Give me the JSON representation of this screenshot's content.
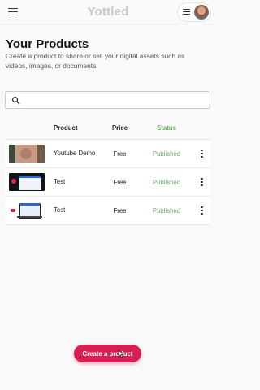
{
  "app": {
    "brand": "Yottled"
  },
  "header": {
    "title": "Your Products",
    "subtitle": "Create a product to share or sell your digital assets such as videos, images, or documents."
  },
  "search": {
    "value": "",
    "placeholder": ""
  },
  "table": {
    "columns": [
      "Product",
      "Price",
      "Status"
    ],
    "rows": [
      {
        "thumbnail": "webcam-face-thumbnail",
        "product": "Youtube Demo",
        "price": "Free",
        "status": "Published"
      },
      {
        "thumbnail": "screen-recording-thumbnail",
        "product": "Test",
        "price": "Free",
        "status": "Published"
      },
      {
        "thumbnail": "laptop-screen-thumbnail",
        "product": "Test",
        "price": "Free",
        "status": "Published"
      }
    ]
  },
  "actions": {
    "create_label": "Create a product"
  },
  "colors": {
    "accent": "#d81f54",
    "published": "#6fa86a",
    "brand": "#c7c7c7"
  },
  "icons": [
    "hamburger-menu-icon",
    "user-menu-icon",
    "search-icon",
    "more-vertical-icon"
  ]
}
